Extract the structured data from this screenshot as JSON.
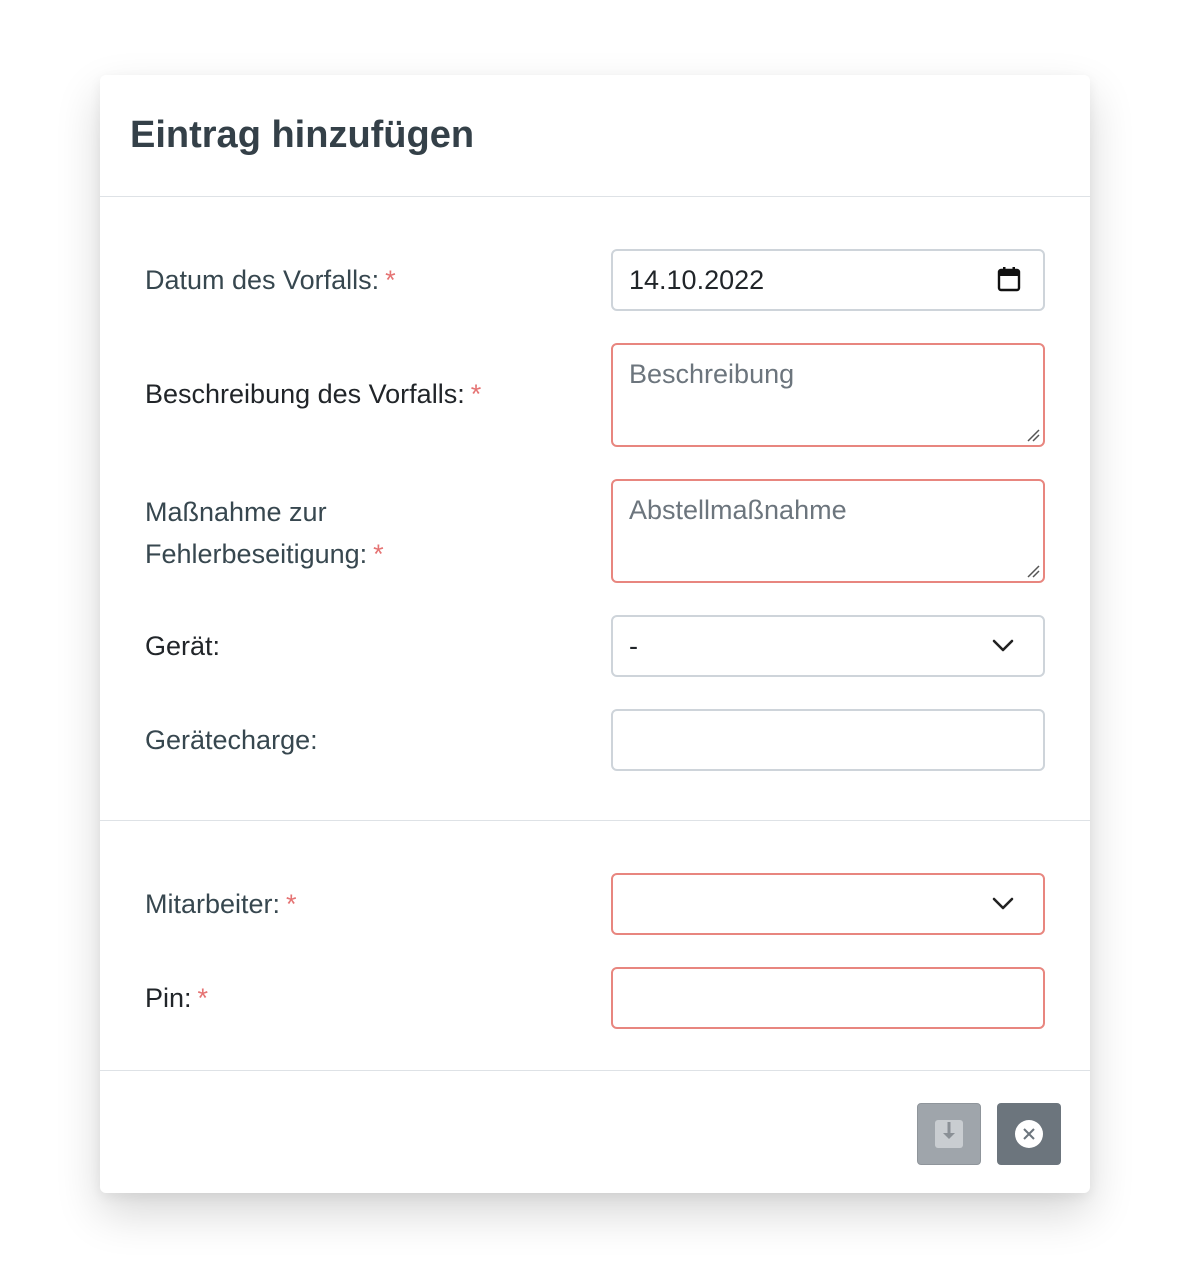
{
  "modal": {
    "title": "Eintrag hinzufügen"
  },
  "form": {
    "date": {
      "label": "Datum des Vorfalls:",
      "required_mark": "*",
      "value": "14.10.2022"
    },
    "description": {
      "label": "Beschreibung des Vorfalls:",
      "required_mark": "*",
      "placeholder": "Beschreibung"
    },
    "measure": {
      "label_line1": "Maßnahme zur",
      "label_line2": "Fehlerbeseitigung:",
      "required_mark": "*",
      "placeholder": "Abstellmaßnahme"
    },
    "device": {
      "label": "Gerät:",
      "selected": "-"
    },
    "device_batch": {
      "label": "Gerätecharge:",
      "value": ""
    },
    "employee": {
      "label": "Mitarbeiter:",
      "required_mark": "*",
      "selected": ""
    },
    "pin": {
      "label": "Pin:",
      "required_mark": "*",
      "value": ""
    }
  },
  "footer": {
    "buttons": [
      {
        "icon": "save-download-icon",
        "state": "disabled"
      },
      {
        "icon": "close-circle-icon",
        "state": "enabled"
      }
    ]
  },
  "colors": {
    "required": "#e57373",
    "invalid_border": "#e8867f",
    "save_button": "#9fa5ab",
    "close_button": "#6c757d"
  }
}
